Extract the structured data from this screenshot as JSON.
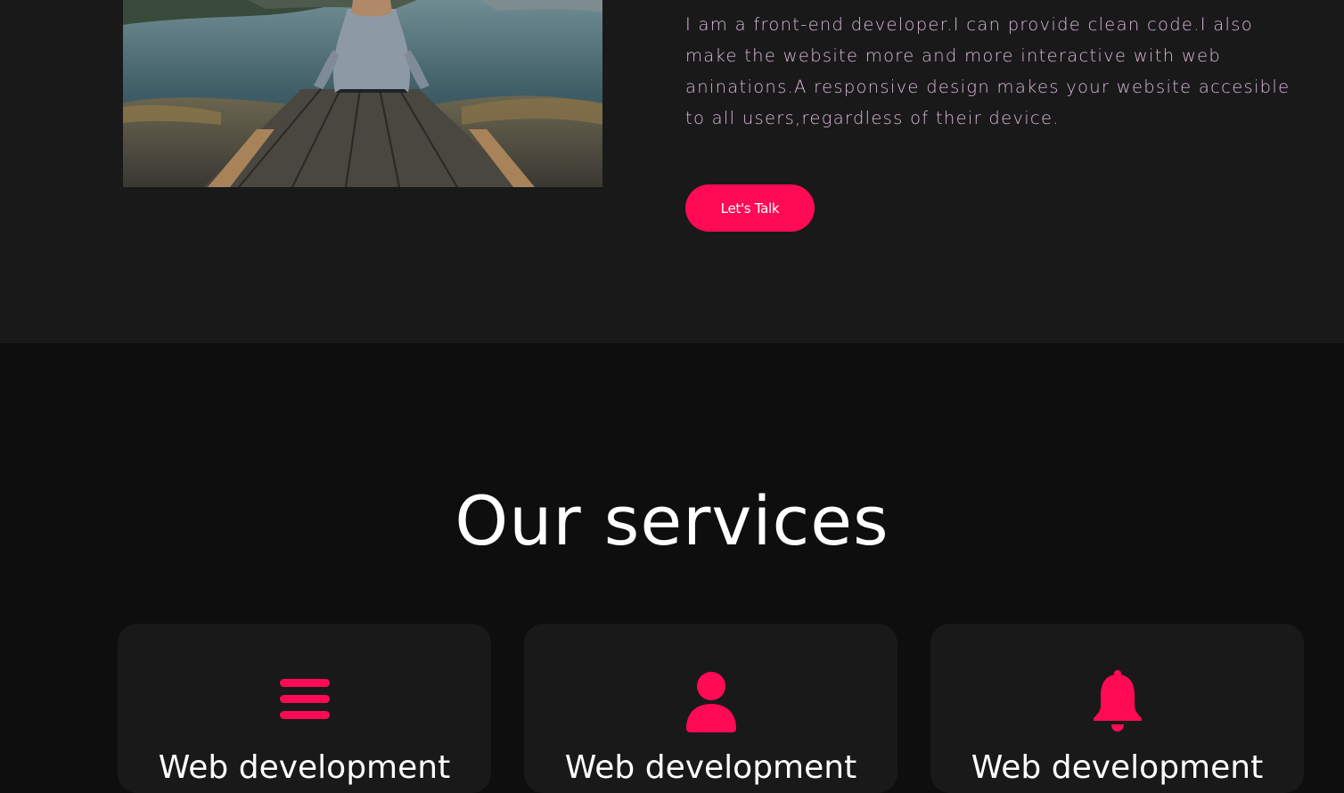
{
  "about": {
    "photo_alt": "Woman sitting on a wooden pier by a lake",
    "text": "I am a front-end developer.I can provide clean code.I also make the website more and more interactive with web aninations.A responsive design makes your website accesible to all users,regardless of their device.",
    "button_label": "Let's Talk"
  },
  "services": {
    "title": "Our services",
    "cards": [
      {
        "icon": "bars-icon",
        "title": "Web development"
      },
      {
        "icon": "user-icon",
        "title": "Web development"
      },
      {
        "icon": "bell-icon",
        "title": "Web development"
      }
    ]
  },
  "colors": {
    "accent": "#ff0a54",
    "about_bg": "#191919",
    "services_bg": "#0e0e0e",
    "card_bg": "#191919",
    "about_text": "#d8b8d8"
  }
}
